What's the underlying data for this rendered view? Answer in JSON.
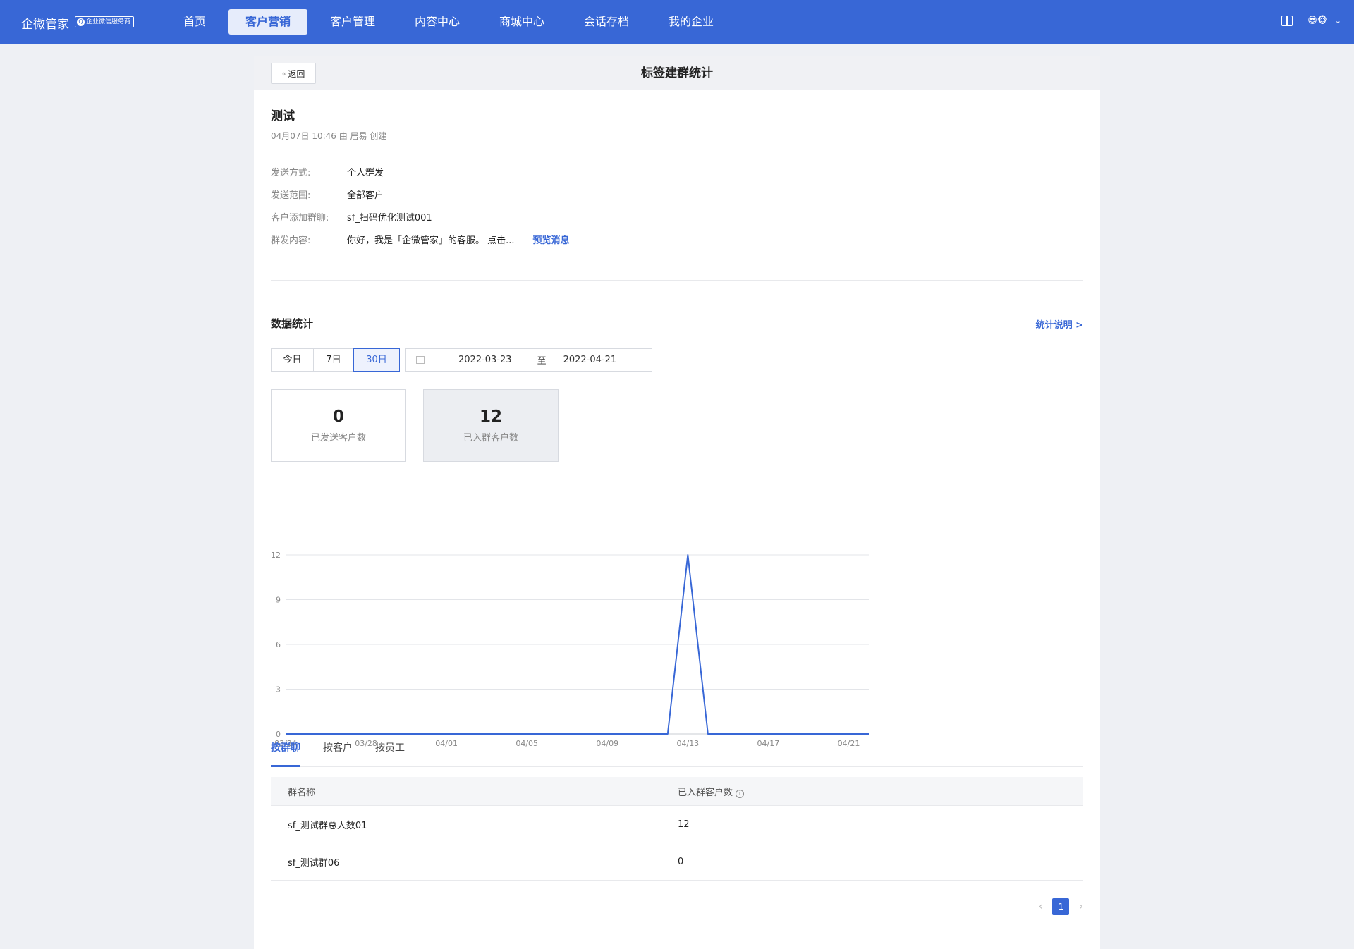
{
  "nav": {
    "brand": "企微管家",
    "badge": "企业微信服务商",
    "items": [
      "首页",
      "客户营销",
      "客户管理",
      "内容中心",
      "商城中心",
      "会话存档",
      "我的企业"
    ],
    "active_index": 1,
    "avatar": "😎🐵"
  },
  "header": {
    "back_label": "返回",
    "title": "标签建群统计"
  },
  "task": {
    "name": "测试",
    "meta": "04月07日 10:46 由 居易 创建",
    "fields": [
      {
        "key": "发送方式:",
        "value": "个人群发"
      },
      {
        "key": "发送范围:",
        "value": "全部客户"
      },
      {
        "key": "客户添加群聊:",
        "value": "sf_扫码优化测试001"
      },
      {
        "key": "群发内容:",
        "value": "你好，我是「企微管家」的客服。 点击..."
      }
    ],
    "preview_label": "预览消息"
  },
  "stats": {
    "title": "数据统计",
    "explain_label": "统计说明 >",
    "ranges": [
      "今日",
      "7日",
      "30日"
    ],
    "active_range": 2,
    "date_start": "2022-03-23",
    "date_sep": "至",
    "date_end": "2022-04-21",
    "cards": [
      {
        "value": "0",
        "label": "已发送客户数"
      },
      {
        "value": "12",
        "label": "已入群客户数"
      }
    ]
  },
  "chart_data": {
    "type": "line",
    "x": [
      "03/24",
      "03/25",
      "03/26",
      "03/27",
      "03/28",
      "03/29",
      "03/30",
      "03/31",
      "04/01",
      "04/02",
      "04/03",
      "04/04",
      "04/05",
      "04/06",
      "04/07",
      "04/08",
      "04/09",
      "04/10",
      "04/11",
      "04/12",
      "04/13",
      "04/14",
      "04/15",
      "04/16",
      "04/17",
      "04/18",
      "04/19",
      "04/20",
      "04/21",
      "04/22"
    ],
    "x_ticks": [
      "03/24",
      "03/28",
      "04/01",
      "04/05",
      "04/09",
      "04/13",
      "04/17",
      "04/21"
    ],
    "series": [
      {
        "values": [
          0,
          0,
          0,
          0,
          0,
          0,
          0,
          0,
          0,
          0,
          0,
          0,
          0,
          0,
          0,
          0,
          0,
          0,
          0,
          0,
          12,
          0,
          0,
          0,
          0,
          0,
          0,
          0,
          0,
          0
        ]
      }
    ],
    "y_ticks": [
      0,
      3,
      6,
      9,
      12
    ],
    "ylim": [
      0,
      12
    ],
    "grid": true,
    "color": "#3867d6"
  },
  "tabs": [
    "按群聊",
    "按客户",
    "按员工"
  ],
  "active_tab": 0,
  "table": {
    "headers": [
      "群名称",
      "已入群客户数"
    ],
    "rows": [
      [
        "sf_测试群总人数01",
        "12"
      ],
      [
        "sf_测试群06",
        "0"
      ]
    ]
  },
  "pager": {
    "current": "1"
  }
}
